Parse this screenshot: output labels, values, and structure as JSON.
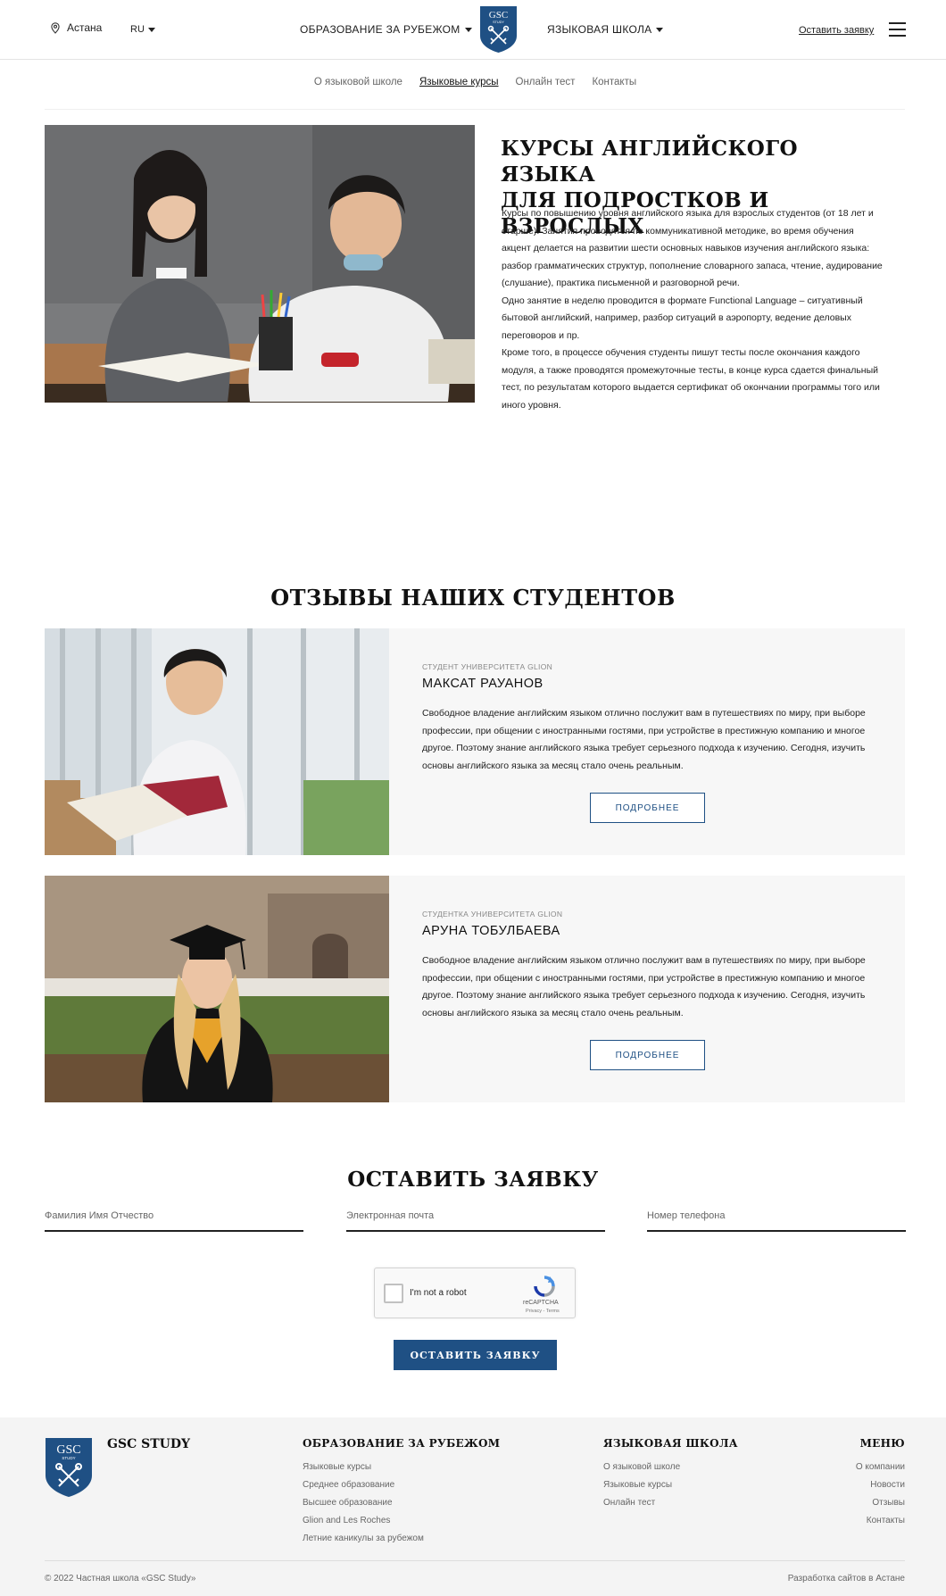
{
  "header": {
    "city": "Астана",
    "lang": "RU",
    "nav_abroad": "ОБРАЗОВАНИЕ ЗА РУБЕЖОМ",
    "nav_school": "ЯЗЫКОВАЯ ШКОЛА",
    "logo_text": "GSC",
    "logo_sub": "STUDY",
    "cta": "Оставить заявку"
  },
  "subnav": {
    "items": [
      "О языковой школе",
      "Языковые курсы",
      "Онлайн тест",
      "Контакты"
    ],
    "active_index": 1
  },
  "hero": {
    "title_line1": "КУРСЫ АНГЛИЙСКОГО ЯЗЫКА",
    "title_line2": "ДЛЯ ПОДРОСТКОВ И ВЗРОСЛЫХ",
    "p1": "Курсы по повышению уровня английского языка для взрослых студентов (от 18 лет и старше): Занятия проводятся по коммуникативной методике, во время обучения акцент делается на развитии шести основных навыков изучения английского языка: разбор грамматических структур, пополнение словарного запаса, чтение, аудирование (слушание), практика письменной и разговорной речи.",
    "p2": "Одно занятие в неделю проводится в формате Functional Language – ситуативный бытовой английский, например, разбор ситуаций в аэропорту, ведение деловых переговоров и пр.",
    "p3": "Кроме того, в процессе обучения студенты пишут тесты после окончания каждого модуля, а также проводятся промежуточные тесты, в конце курса сдается финальный тест, по результатам которого выдается сертификат об окончании программы того или иного уровня."
  },
  "reviews": {
    "title": "ОТЗЫВЫ НАШИХ СТУДЕНТОВ",
    "items": [
      {
        "role": "СТУДЕНТ УНИВЕРСИТЕТА GLION",
        "name": "МАКСАТ РАУАНОВ",
        "text": "Свободное владение английским языком отлично послужит вам в путешествиях по миру, при выборе профессии, при общении с иностранными гостями, при устройстве в престижную компанию и многое другое. Поэтому знание английского языка требует серьезного подхода к изучению. Сегодня, изучить основы английского языка за месяц стало очень реальным.",
        "button": "ПОДРОБНЕЕ"
      },
      {
        "role": "СТУДЕНТКА УНИВЕРСИТЕТА GLION",
        "name": "АРУНА ТОБУЛБАЕВА",
        "text": "Свободное владение английским языком отлично послужит вам в путешествиях по миру, при выборе профессии, при общении с иностранными гостями, при устройстве в престижную компанию и многое другое. Поэтому знание английского языка требует серьезного подхода к изучению. Сегодня, изучить основы английского языка за месяц стало очень реальным.",
        "button": "ПОДРОБНЕЕ"
      }
    ]
  },
  "form": {
    "title": "ОСТАВИТЬ ЗАЯВКУ",
    "name_placeholder": "Фамилия Имя Отчество",
    "email_placeholder": "Электронная почта",
    "phone_placeholder": "Номер телефона",
    "captcha_label": "I'm not a robot",
    "captcha_brand": "reCAPTCHA",
    "captcha_terms": "Privacy - Terms",
    "submit": "ОСТАВИТЬ ЗАЯВКУ"
  },
  "footer": {
    "brand": "GSC STUDY",
    "col1": {
      "title": "ОБРАЗОВАНИЕ ЗА РУБЕЖОМ",
      "links": [
        "Языковые курсы",
        "Среднее образование",
        "Высшее образование",
        "Glion and Les Roches",
        "Летние каникулы за рубежом"
      ]
    },
    "col2": {
      "title": "ЯЗЫКОВАЯ ШКОЛА",
      "links": [
        "О языковой школе",
        "Языковые курсы",
        "Онлайн тест"
      ]
    },
    "col3": {
      "title": "МЕНЮ",
      "links": [
        "О компании",
        "Новости",
        "Отзывы",
        "Контакты"
      ]
    },
    "copyright": "© 2022 Частная школа «GSC Study»",
    "developer": "Разработка сайтов в Астане"
  },
  "colors": {
    "brand_blue": "#1f5084",
    "footer_bg": "#f4f4f4",
    "review_bg": "#f7f7f7"
  }
}
